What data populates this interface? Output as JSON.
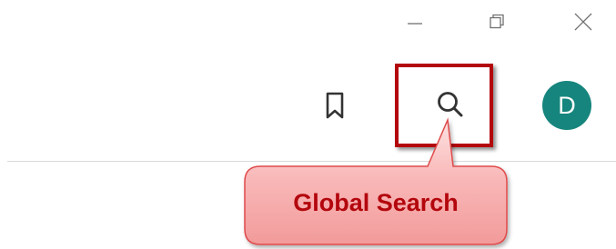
{
  "window_controls": {
    "minimize_icon": "minimize-icon",
    "restore_icon": "restore-icon",
    "close_icon": "close-icon"
  },
  "toolbar": {
    "bookmark_icon": "bookmark-icon",
    "search_icon": "search-icon",
    "avatar_initial": "D",
    "avatar_color": "#16857d"
  },
  "annotation": {
    "callout_label": "Global Search",
    "highlight_color": "#b3070d"
  }
}
